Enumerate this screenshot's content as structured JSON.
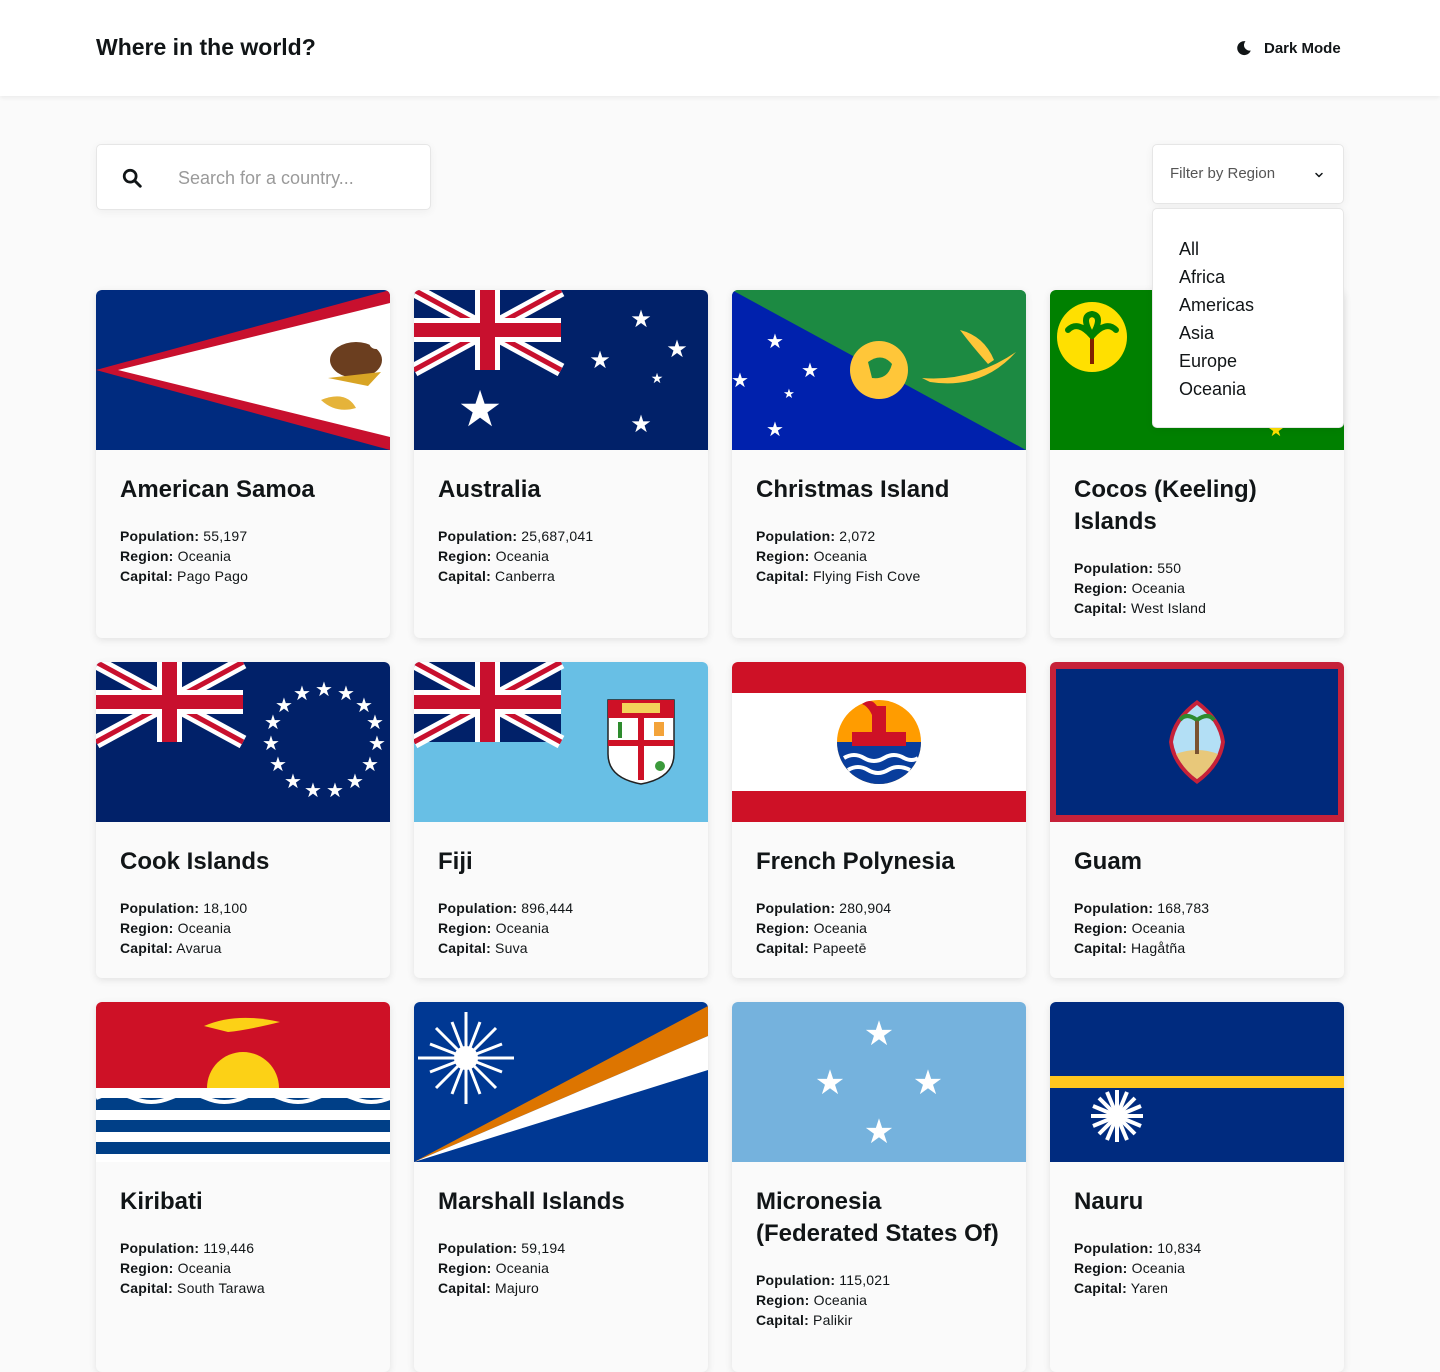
{
  "header": {
    "title": "Where in the world?",
    "mode_label": "Dark Mode"
  },
  "search": {
    "placeholder": "Search for a country...",
    "value": ""
  },
  "filter": {
    "label": "Filter by Region",
    "options": [
      "All",
      "Africa",
      "Americas",
      "Asia",
      "Europe",
      "Oceania"
    ]
  },
  "field_labels": {
    "population": "Population:",
    "region": "Region:",
    "capital": "Capital:"
  },
  "countries": [
    {
      "name": "American Samoa",
      "population": "55,197",
      "region": "Oceania",
      "capital": "Pago Pago",
      "flag": "american-samoa-flag"
    },
    {
      "name": "Australia",
      "population": "25,687,041",
      "region": "Oceania",
      "capital": "Canberra",
      "flag": "australia-flag"
    },
    {
      "name": "Christmas Island",
      "population": "2,072",
      "region": "Oceania",
      "capital": "Flying Fish Cove",
      "flag": "christmas-island-flag"
    },
    {
      "name": "Cocos (Keeling) Islands",
      "population": "550",
      "region": "Oceania",
      "capital": "West Island",
      "flag": "cocos-islands-flag"
    },
    {
      "name": "Cook Islands",
      "population": "18,100",
      "region": "Oceania",
      "capital": "Avarua",
      "flag": "cook-islands-flag"
    },
    {
      "name": "Fiji",
      "population": "896,444",
      "region": "Oceania",
      "capital": "Suva",
      "flag": "fiji-flag"
    },
    {
      "name": "French Polynesia",
      "population": "280,904",
      "region": "Oceania",
      "capital": "Papeetē",
      "flag": "french-polynesia-flag"
    },
    {
      "name": "Guam",
      "population": "168,783",
      "region": "Oceania",
      "capital": "Hagåtña",
      "flag": "guam-flag"
    },
    {
      "name": "Kiribati",
      "population": "119,446",
      "region": "Oceania",
      "capital": "South Tarawa",
      "flag": "kiribati-flag"
    },
    {
      "name": "Marshall Islands",
      "population": "59,194",
      "region": "Oceania",
      "capital": "Majuro",
      "flag": "marshall-islands-flag"
    },
    {
      "name": "Micronesia (Federated States Of)",
      "population": "115,021",
      "region": "Oceania",
      "capital": "Palikir",
      "flag": "micronesia-flag"
    },
    {
      "name": "Nauru",
      "population": "10,834",
      "region": "Oceania",
      "capital": "Yaren",
      "flag": "nauru-flag"
    }
  ]
}
